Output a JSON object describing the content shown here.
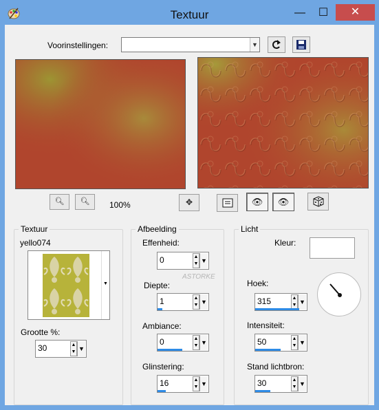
{
  "window": {
    "title": "Textuur",
    "minimize_glyph": "—",
    "maximize_glyph": "☐",
    "close_glyph": "✕"
  },
  "presets": {
    "label": "Voorinstellingen:",
    "value": ""
  },
  "zoom": {
    "percent": "100%"
  },
  "texture": {
    "group": "Textuur",
    "name": "yello074",
    "size_label": "Grootte %:",
    "size_value": "30"
  },
  "image": {
    "group": "Afbeelding",
    "smoothness_label": "Effenheid:",
    "smoothness_value": "0",
    "smoothness_level": 0,
    "depth_label": "Diepte:",
    "depth_value": "1",
    "depth_level": 0.1,
    "ambiance_label": "Ambiance:",
    "ambiance_value": "0",
    "ambiance_level": 0.5,
    "shininess_label": "Glinstering:",
    "shininess_value": "16",
    "shininess_level": 0.16
  },
  "light": {
    "group": "Licht",
    "color_label": "Kleur:",
    "color": "#ffffff",
    "angle_label": "Hoek:",
    "angle_value": "315",
    "angle_level": 0.875,
    "intensity_label": "Intensiteit:",
    "intensity_value": "50",
    "intensity_level": 0.5,
    "position_label": "Stand lichtbron:",
    "position_value": "30",
    "position_level": 0.3
  },
  "watermark": {
    "text": "ASTORKE"
  },
  "colors": {
    "accent": "#2e8be6",
    "titlebar": "#6fa6e2",
    "close": "#c74d4d",
    "preview_warm": "#b0452d",
    "preview_yellow": "#9d9433"
  }
}
